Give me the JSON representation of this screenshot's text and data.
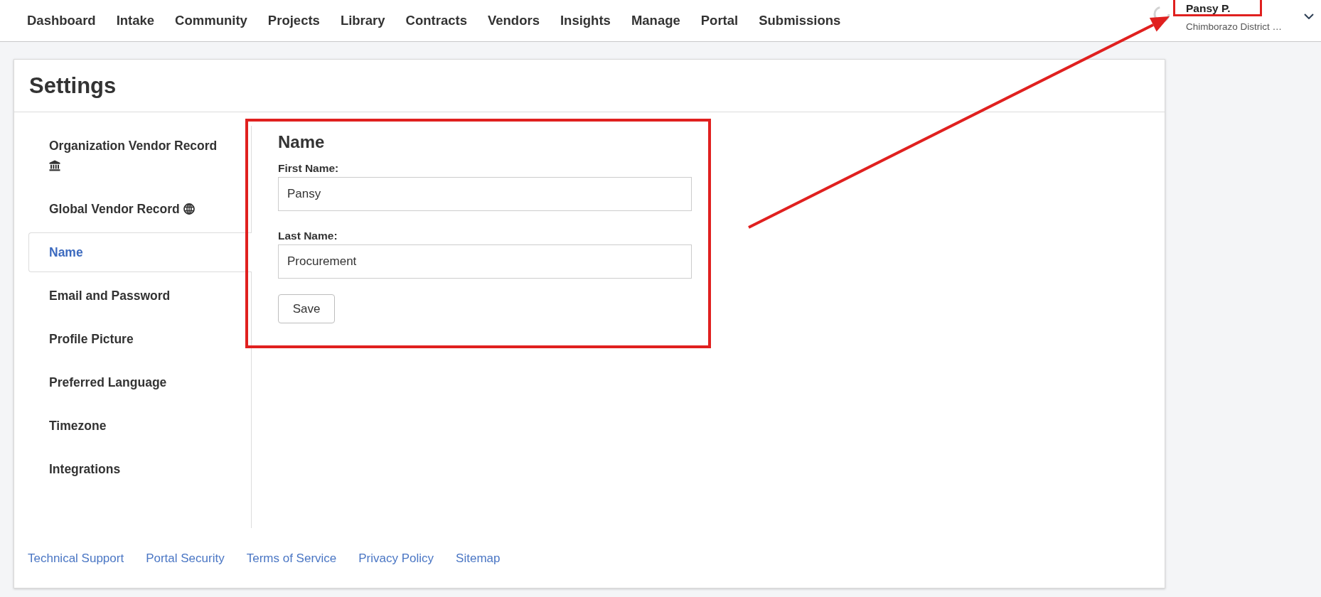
{
  "nav": [
    "Dashboard",
    "Intake",
    "Community",
    "Projects",
    "Library",
    "Contracts",
    "Vendors",
    "Insights",
    "Manage",
    "Portal",
    "Submissions"
  ],
  "user": {
    "name": "Pansy P.",
    "organization": "Chimborazo District …",
    "highlighted": true
  },
  "page": {
    "title": "Settings"
  },
  "sidebar": {
    "items": [
      {
        "label": "Organization Vendor Record",
        "kind": "organization",
        "selected": false
      },
      {
        "label": "Global Vendor Record",
        "kind": "global",
        "selected": false
      },
      {
        "label": "Name",
        "kind": "page",
        "selected": true
      },
      {
        "label": "Email and Password",
        "kind": "page",
        "selected": false
      },
      {
        "label": "Profile Picture",
        "kind": "page",
        "selected": false
      },
      {
        "label": "Preferred Language",
        "kind": "page",
        "selected": false
      },
      {
        "label": "Timezone",
        "kind": "page",
        "selected": false
      },
      {
        "label": "Integrations",
        "kind": "page",
        "selected": false
      }
    ]
  },
  "name_form": {
    "heading": "Name",
    "highlighted": true,
    "fields": [
      {
        "label": "First Name:",
        "value": "Pansy"
      },
      {
        "label": "Last Name:",
        "value": "Procurement"
      }
    ],
    "save_button": "Save"
  },
  "footer": {
    "links": [
      "Technical Support",
      "Portal Security",
      "Terms of Service",
      "Privacy Policy",
      "Sitemap"
    ]
  }
}
